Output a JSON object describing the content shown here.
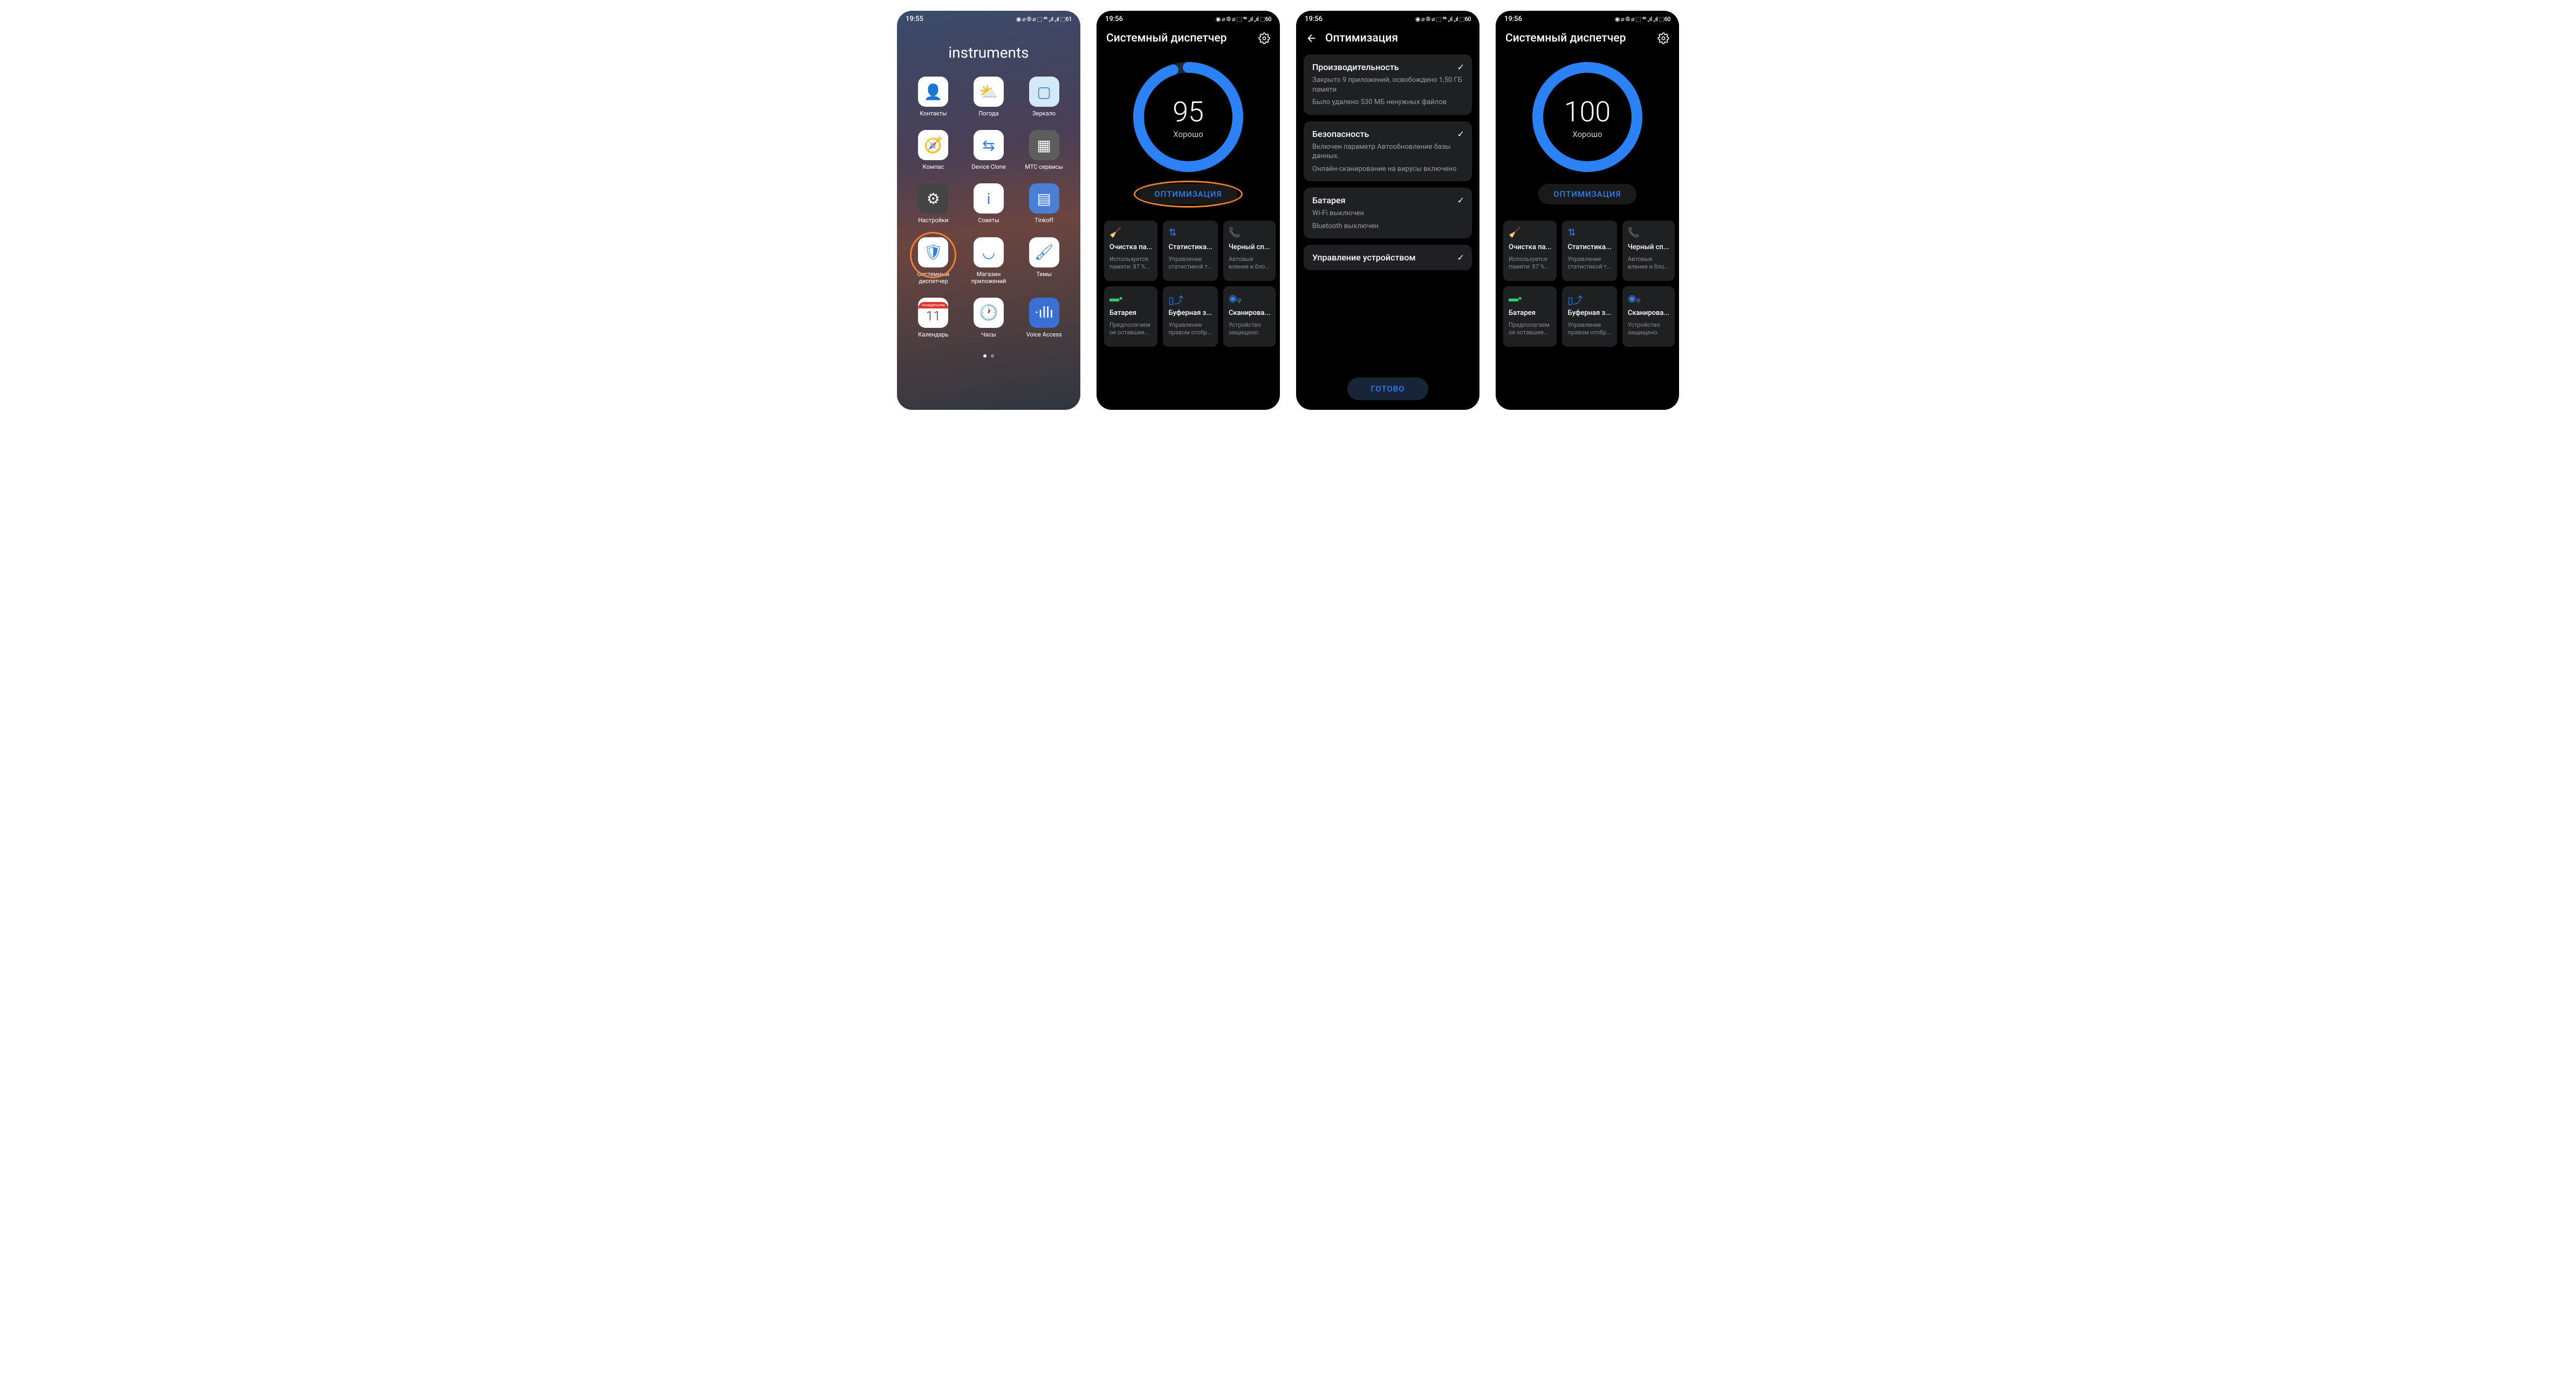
{
  "screens": {
    "home": {
      "time": "19:55",
      "status_icons": "◉ ⌀ ⦾ ⌀ ⬚ ⁴⁶ ₊ıl ₊ıl ⬚61",
      "folder_title": "instruments",
      "apps": [
        {
          "label": "Контакты",
          "icon": "👤",
          "bg": "#fff"
        },
        {
          "label": "Погода",
          "icon": "⛅",
          "bg": "#fff"
        },
        {
          "label": "Зеркало",
          "icon": "▢",
          "bg": "#d4e9f7"
        },
        {
          "label": "Компас",
          "icon": "🧭",
          "bg": "#fff"
        },
        {
          "label": "Device Clone",
          "icon": "⇆",
          "bg": "#fff"
        },
        {
          "label": "МТС сервисы",
          "icon": "▦",
          "bg": "#5d5d5d"
        },
        {
          "label": "Настройки",
          "icon": "⚙",
          "bg": "#444"
        },
        {
          "label": "Советы",
          "icon": "i",
          "bg": "#fff"
        },
        {
          "label": "Tinkoff",
          "icon": "▤",
          "bg": "#4a7fd4"
        },
        {
          "label": "Системный диспетчер",
          "icon": "🛡",
          "bg": "#fff"
        },
        {
          "label": "Магазин приложений",
          "icon": "◡",
          "bg": "#fff"
        },
        {
          "label": "Темы",
          "icon": "🖌",
          "bg": "#fff"
        },
        {
          "label": "Календарь",
          "icon": "11",
          "bg": "#fff",
          "banner": "понедельник"
        },
        {
          "label": "Часы",
          "icon": "🕐",
          "bg": "#fff"
        },
        {
          "label": "Voice Access",
          "icon": "·ıllı",
          "bg": "#3a6fd4"
        }
      ]
    },
    "manager95": {
      "time": "19:56",
      "status_icons": "◉ ⌀ ⦾ ⌀ ⬚ ⁴⁶ ₊ıl ₊ıl ⬚60",
      "title": "Системный диспетчер",
      "score": "95",
      "score_sub": "Хорошо",
      "optimize_btn": "ОПТИМИЗАЦИЯ",
      "progress_pct": 95
    },
    "optimize": {
      "time": "19:56",
      "status_icons": "◉ ⌀ ⦾ ⌀ ⬚ ⁴⁶ ₊ıl ₊ıl ⬚60",
      "title": "Оптимизация",
      "cards": [
        {
          "title": "Производительность",
          "lines": [
            "Закрыто 9 приложений, освобождено 1,50 ГБ памяти",
            "Было удалено 530 МБ ненужных файлов"
          ]
        },
        {
          "title": "Безопасность",
          "lines": [
            "Включен параметр Автообновление базы данных.",
            "Онлайн-сканирование на вирусы включено"
          ]
        },
        {
          "title": "Батарея",
          "lines": [
            "Wi-Fi выключен",
            "Bluetooth выключен"
          ]
        },
        {
          "title": "Управление устройством",
          "lines": []
        }
      ],
      "done_btn": "ГОТОВО"
    },
    "manager100": {
      "time": "19:56",
      "status_icons": "◉ ⌀ ⦾ ⌀ ⬚ ⁴⁶ ₊ıl ₊ıl ⬚60",
      "title": "Системный диспетчер",
      "score": "100",
      "score_sub": "Хорошо",
      "optimize_btn": "ОПТИМИЗАЦИЯ",
      "progress_pct": 100
    },
    "tiles": [
      {
        "icon": "🧹",
        "cls": "ic-brush",
        "title": "Очистка па...",
        "sub": "Используется памяти: 87 %..."
      },
      {
        "icon": "⇅",
        "cls": "ic-data",
        "title": "Статистика...",
        "sub": "Управление статистикой т..."
      },
      {
        "icon": "📞",
        "cls": "ic-phone",
        "title": "Черный сп...",
        "sub": "Автовыя вление и бло..."
      },
      {
        "icon": "▬▪",
        "cls": "ic-batt",
        "title": "Батарея",
        "sub": "Предполагаем ое оставшее..."
      },
      {
        "icon": "▯⤴",
        "cls": "ic-cache",
        "title": "Буферная з...",
        "sub": "Управление правом отобр..."
      },
      {
        "icon": "◉ᵩ",
        "cls": "ic-scan",
        "title": "Сканирова...",
        "sub": "Устройство защищено."
      }
    ]
  }
}
